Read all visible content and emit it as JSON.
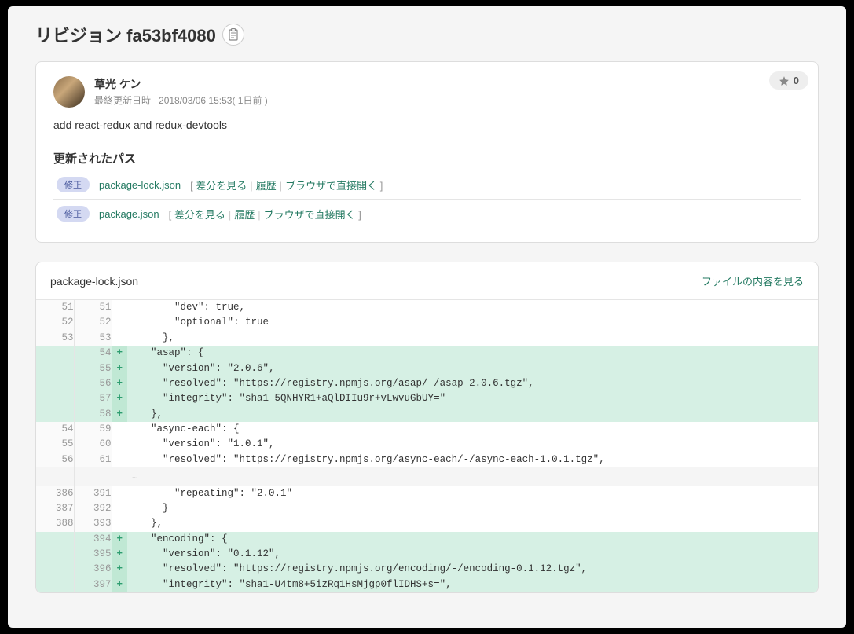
{
  "revision": {
    "prefix": "リビジョン",
    "hash": "fa53bf4080"
  },
  "author": {
    "name": "草光 ケン",
    "date_label": "最終更新日時",
    "date": "2018/03/06 15:53( 1日前 )"
  },
  "star_count": "0",
  "commit_message": "add react-redux and redux-devtools",
  "paths_title": "更新されたパス",
  "mod_badge": "修正",
  "actions": {
    "diff": "差分を見る",
    "history": "履歴",
    "browser": "ブラウザで直接開く"
  },
  "paths": [
    {
      "name": "package-lock.json"
    },
    {
      "name": "package.json"
    }
  ],
  "diff": {
    "filename": "package-lock.json",
    "view_label": "ファイルの内容を見る"
  },
  "diff_lines": [
    {
      "old": "51",
      "new": "51",
      "type": "ctx",
      "text": "        \"dev\": true,"
    },
    {
      "old": "52",
      "new": "52",
      "type": "ctx",
      "text": "        \"optional\": true"
    },
    {
      "old": "53",
      "new": "53",
      "type": "ctx",
      "text": "      },"
    },
    {
      "old": "",
      "new": "54",
      "type": "add",
      "text": "    \"asap\": {"
    },
    {
      "old": "",
      "new": "55",
      "type": "add",
      "text": "      \"version\": \"2.0.6\","
    },
    {
      "old": "",
      "new": "56",
      "type": "add",
      "text": "      \"resolved\": \"https://registry.npmjs.org/asap/-/asap-2.0.6.tgz\","
    },
    {
      "old": "",
      "new": "57",
      "type": "add",
      "text": "      \"integrity\": \"sha1-5QNHYR1+aQlDIIu9r+vLwvuGbUY=\""
    },
    {
      "old": "",
      "new": "58",
      "type": "add",
      "text": "    },"
    },
    {
      "old": "54",
      "new": "59",
      "type": "ctx",
      "text": "    \"async-each\": {"
    },
    {
      "old": "55",
      "new": "60",
      "type": "ctx",
      "text": "      \"version\": \"1.0.1\","
    },
    {
      "old": "56",
      "new": "61",
      "type": "ctx",
      "text": "      \"resolved\": \"https://registry.npmjs.org/async-each/-/async-each-1.0.1.tgz\","
    },
    {
      "type": "gap",
      "text": "…"
    },
    {
      "old": "386",
      "new": "391",
      "type": "ctx",
      "text": "        \"repeating\": \"2.0.1\""
    },
    {
      "old": "387",
      "new": "392",
      "type": "ctx",
      "text": "      }"
    },
    {
      "old": "388",
      "new": "393",
      "type": "ctx",
      "text": "    },"
    },
    {
      "old": "",
      "new": "394",
      "type": "add",
      "text": "    \"encoding\": {"
    },
    {
      "old": "",
      "new": "395",
      "type": "add",
      "text": "      \"version\": \"0.1.12\","
    },
    {
      "old": "",
      "new": "396",
      "type": "add",
      "text": "      \"resolved\": \"https://registry.npmjs.org/encoding/-/encoding-0.1.12.tgz\","
    },
    {
      "old": "",
      "new": "397",
      "type": "add",
      "text": "      \"integrity\": \"sha1-U4tm8+5izRq1HsMjgp0flIDHS+s=\","
    }
  ]
}
